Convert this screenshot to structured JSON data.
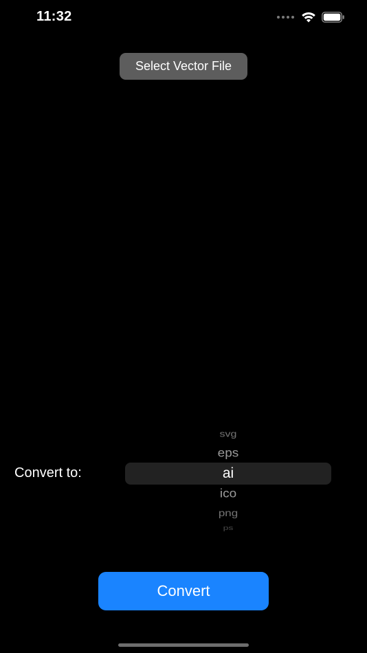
{
  "status_bar": {
    "time": "11:32",
    "icons": [
      "cellular-signal-icon",
      "wifi-icon",
      "battery-icon"
    ]
  },
  "select_button": {
    "label": "Select Vector File"
  },
  "converter": {
    "label": "Convert to:",
    "picker": {
      "options": [
        "svg",
        "eps",
        "ai",
        "ico",
        "png",
        "ps"
      ],
      "selected": "ai"
    }
  },
  "convert_button": {
    "label": "Convert"
  },
  "colors": {
    "background": "#000000",
    "accent": "#1a84ff",
    "secondary_button": "#5d5d5d",
    "picker_highlight": "#222222"
  }
}
